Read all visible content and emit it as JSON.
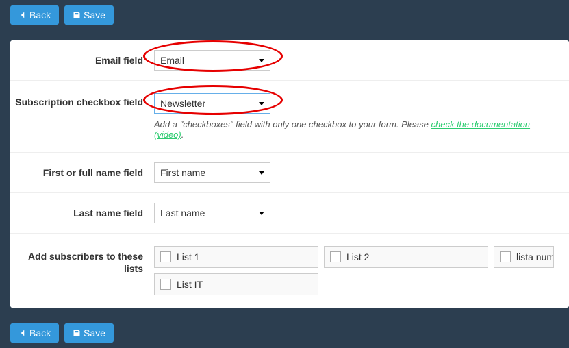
{
  "toolbar": {
    "back_label": "Back",
    "save_label": "Save"
  },
  "fields": {
    "email": {
      "label": "Email field",
      "value": "Email"
    },
    "subscription": {
      "label": "Subscription checkbox field",
      "value": "Newsletter",
      "help_prefix": "Add a \"checkboxes\" field with only one checkbox to your form. Please ",
      "help_link": "check the documentation (video)",
      "help_suffix": "."
    },
    "firstname": {
      "label": "First or full name field",
      "value": "First name"
    },
    "lastname": {
      "label": "Last name field",
      "value": "Last name"
    },
    "lists": {
      "label": "Add subscribers to these lists",
      "items": [
        {
          "label": "List 1"
        },
        {
          "label": "List 2"
        },
        {
          "label": "lista num"
        },
        {
          "label": "List IT"
        }
      ]
    }
  },
  "annotations": {
    "highlight_color": "#e60000"
  }
}
